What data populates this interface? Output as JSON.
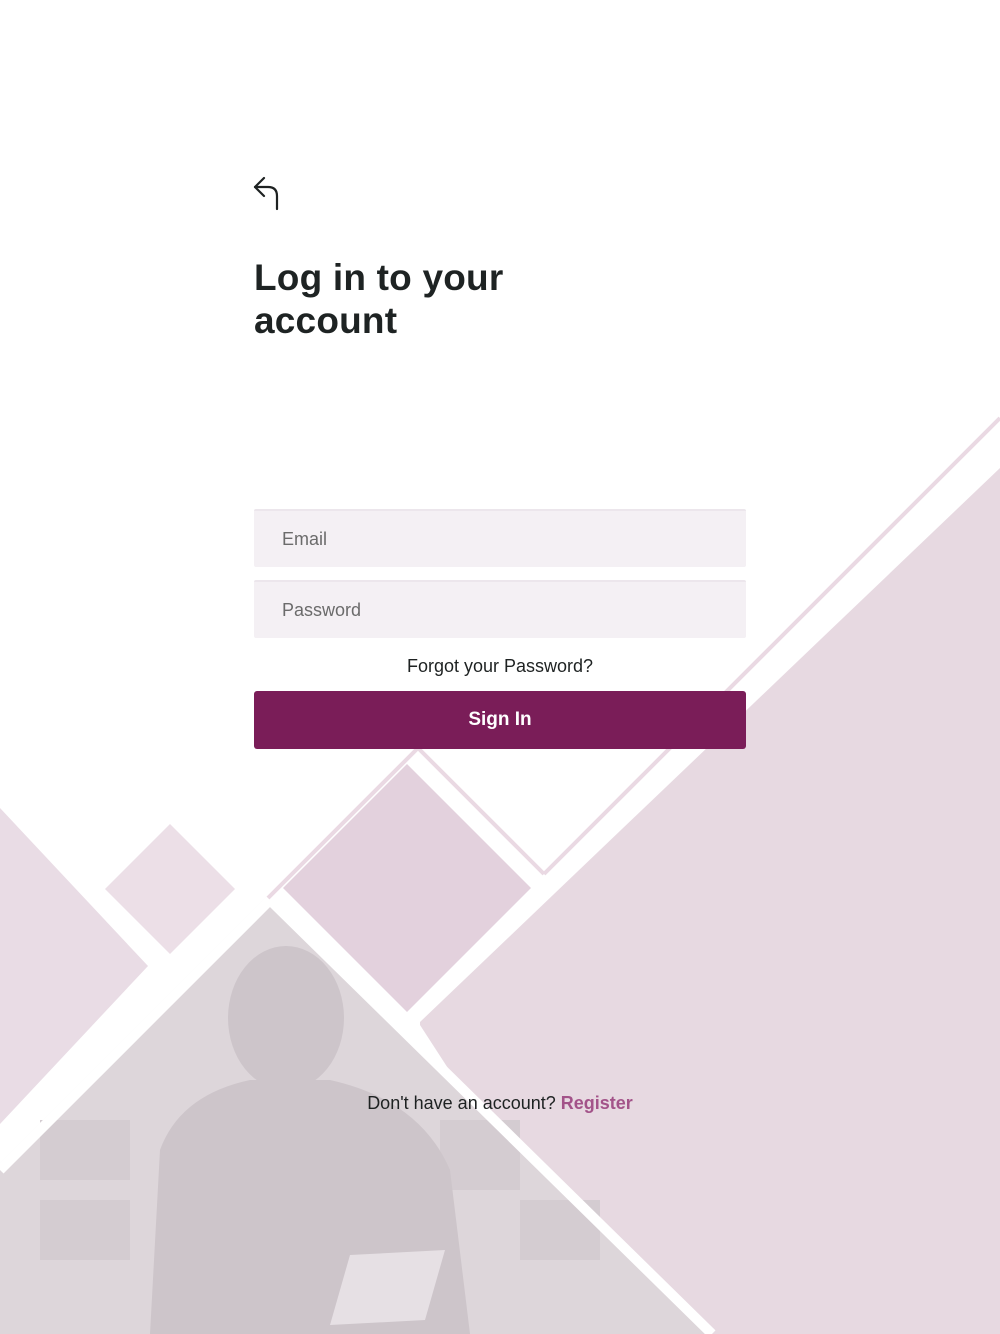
{
  "header": {
    "back_icon": "arrow-back-icon",
    "title": "Log in to your account"
  },
  "form": {
    "email_placeholder": "Email",
    "password_placeholder": "Password",
    "forgot_password_label": "Forgot your Password?",
    "signin_label": "Sign In"
  },
  "footer": {
    "prompt": "Don't have an account?",
    "register_label": "Register"
  },
  "colors": {
    "primary": "#7a1d58",
    "link": "#a35389",
    "background_tint": "#e8d9e2",
    "input_background": "#f4f0f4"
  }
}
